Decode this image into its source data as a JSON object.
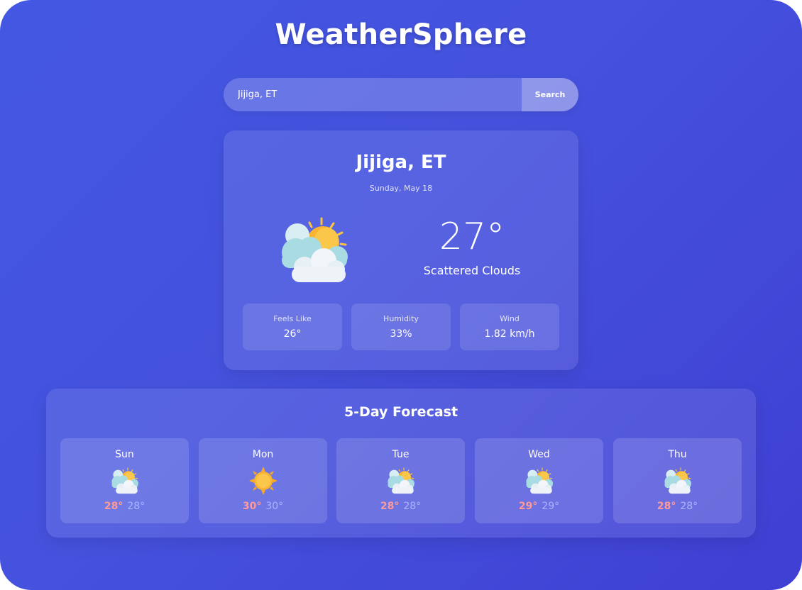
{
  "app": {
    "title": "WeatherSphere"
  },
  "search": {
    "value": "Jijiga, ET",
    "button_label": "Search"
  },
  "current": {
    "city": "Jijiga, ET",
    "date": "Sunday, May 18",
    "temp": "27°",
    "condition": "Scattered Clouds",
    "icon": "partly-cloudy-icon",
    "stats": [
      {
        "label": "Feels Like",
        "value": "26°"
      },
      {
        "label": "Humidity",
        "value": "33%"
      },
      {
        "label": "Wind",
        "value": "1.82 km/h"
      }
    ]
  },
  "forecast": {
    "title": "5-Day Forecast",
    "days": [
      {
        "day": "Sun",
        "icon": "partly-cloudy-icon",
        "high": "28°",
        "low": "28°"
      },
      {
        "day": "Mon",
        "icon": "sun-icon",
        "high": "30°",
        "low": "30°"
      },
      {
        "day": "Tue",
        "icon": "partly-cloudy-icon",
        "high": "28°",
        "low": "28°"
      },
      {
        "day": "Wed",
        "icon": "partly-cloudy-icon",
        "high": "29°",
        "low": "29°"
      },
      {
        "day": "Thu",
        "icon": "partly-cloudy-icon",
        "high": "28°",
        "low": "28°"
      }
    ]
  },
  "colors": {
    "high_temp": "#ff9a9a",
    "low_temp": "#a9b5ff",
    "sun": "#f9b531",
    "background_start": "#4357e3",
    "background_end": "#3f3fd3"
  }
}
